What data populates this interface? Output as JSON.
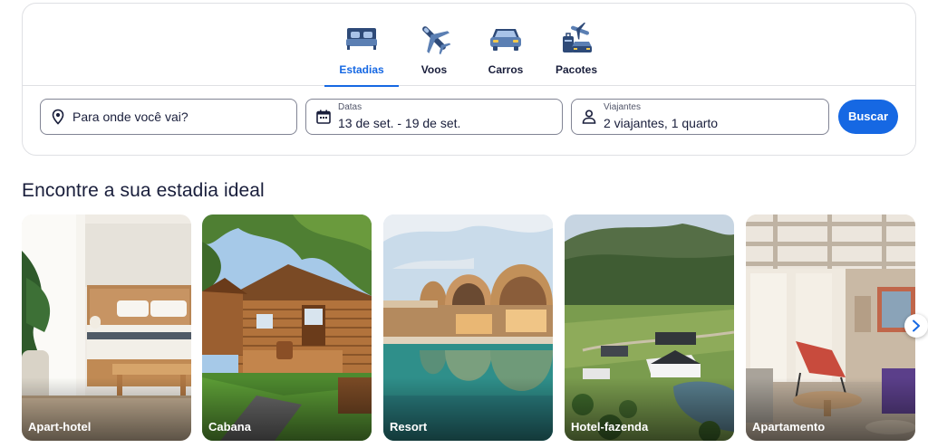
{
  "tabs": [
    {
      "label": "Estadias",
      "icon": "bed-icon",
      "active": true
    },
    {
      "label": "Voos",
      "icon": "airplane-icon",
      "active": false
    },
    {
      "label": "Carros",
      "icon": "car-icon",
      "active": false
    },
    {
      "label": "Pacotes",
      "icon": "package-icon",
      "active": false
    }
  ],
  "search": {
    "destination": {
      "placeholder": "Para onde você vai?",
      "icon": "location-pin-icon"
    },
    "dates": {
      "label": "Datas",
      "value": "13 de set. - 19 de set.",
      "icon": "calendar-icon"
    },
    "travelers": {
      "label": "Viajantes",
      "value": "2 viajantes, 1 quarto",
      "icon": "person-icon"
    },
    "button_label": "Buscar"
  },
  "section": {
    "title": "Encontre a sua estadia ideal",
    "cards": [
      {
        "label": "Apart-hotel"
      },
      {
        "label": "Cabana"
      },
      {
        "label": "Resort"
      },
      {
        "label": "Hotel-fazenda"
      },
      {
        "label": "Apartamento"
      }
    ],
    "next_icon": "chevron-right-icon"
  },
  "colors": {
    "accent": "#1668e3",
    "text": "#191e3b",
    "border": "#dfe0e4"
  }
}
